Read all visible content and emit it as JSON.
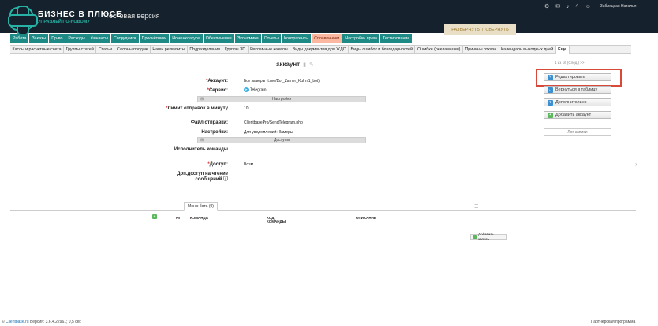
{
  "header": {
    "brand": "БИЗНЕС В ПЛЮСЕ",
    "tagline": "УПРАВЛЕЙ ПО-НОВОМУ",
    "test_version": "Тестовая версия",
    "username": "Заблоцкая Наталья",
    "expand_label": "РАЗВЕРНУТЬ",
    "collapse_label": "СВЕРНУТЬ"
  },
  "main_nav": [
    "Работа",
    "Заказы",
    "Пр-во",
    "Расходы",
    "Финансы",
    "Сотрудники",
    "Просчётники",
    "Номенклатура",
    "Обеспечение",
    "Экономика",
    "Отчеты",
    "Контрагенты",
    "Справочники",
    "Настройки пр-ва",
    "Тестирование"
  ],
  "sub_nav": [
    "Кассы и расчетные счета",
    "Группы статей",
    "Статьи",
    "Салоны продаж",
    "Наши реквизиты",
    "Подразделения",
    "Группы ЗП",
    "Рекламные каналы",
    "Виды документов для ЖДС",
    "Виды ошибок и благодарностей",
    "Ошибки (рекламации)",
    "Причины отказа",
    "Календарь выходных дней",
    "Еще"
  ],
  "pager": "1 из 16 (След.)  >>",
  "record": {
    "title": "аккаунт",
    "fields": {
      "account_label": "Аккаунт:",
      "account_value": "Бот замеры (t.me/Bot_Zamer_Kuhni1_bot)",
      "service_label": "Сервис:",
      "service_value": "Telegram",
      "section_settings": "Настройки",
      "limit_label": "Лимит отправок в минуту",
      "limit_value": "10",
      "file_label": "Файл отправки:",
      "file_value": "ClientbasePro/SendTelegram.php",
      "settings_label": "Настройки:",
      "settings_value": "Для уведомлений: Замеры",
      "section_access": "Доступы",
      "executor_label": "Исполнитель команды",
      "access_label": "Доступ:",
      "access_value": "Всем",
      "extra_access_label": "Доп.доступ на чтение сообщений"
    }
  },
  "buttons": {
    "edit": "Редактировать",
    "back": "Вернуться в таблицу",
    "more": "Дополнительно",
    "add_account": "Добавить аккаунт",
    "log": "Лог записи"
  },
  "subtable": {
    "tab": "Меню бота (0)",
    "col_num": "№",
    "col_command": "КОМАНДА",
    "col_code": "КОД КОМАНДЫ",
    "col_desc": "ОПИСАНИЕ",
    "add_record": "Добавить запись"
  },
  "footer": {
    "site": "Clientbase.ru",
    "version": "Версия: 3.6.4.22961; 0,5 сек",
    "partner": "Партнерская программа"
  }
}
